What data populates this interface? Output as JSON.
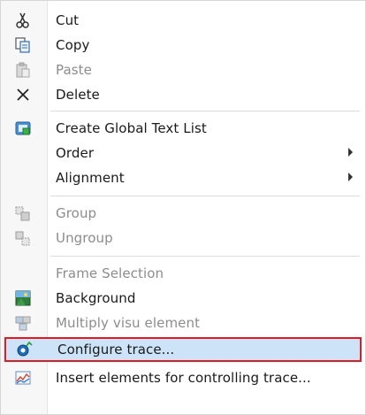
{
  "menu": {
    "items": [
      {
        "label": "Cut",
        "icon": "scissors-icon",
        "disabled": false
      },
      {
        "label": "Copy",
        "icon": "copy-icon",
        "disabled": false
      },
      {
        "label": "Paste",
        "icon": "paste-icon",
        "disabled": true
      },
      {
        "label": "Delete",
        "icon": "delete-icon",
        "disabled": false
      },
      {
        "label": "Create Global Text List",
        "icon": "text-list-icon",
        "disabled": false
      },
      {
        "label": "Order",
        "icon": "",
        "disabled": false,
        "submenu": true
      },
      {
        "label": "Alignment",
        "icon": "",
        "disabled": false,
        "submenu": true
      },
      {
        "label": "Group",
        "icon": "group-icon",
        "disabled": true
      },
      {
        "label": "Ungroup",
        "icon": "ungroup-icon",
        "disabled": true
      },
      {
        "label": "Frame Selection",
        "icon": "",
        "disabled": true
      },
      {
        "label": "Background",
        "icon": "background-icon",
        "disabled": false
      },
      {
        "label": "Multiply visu element",
        "icon": "multiply-icon",
        "disabled": true
      },
      {
        "label": "Configure trace...",
        "icon": "trace-config-icon",
        "disabled": false,
        "highlighted": true
      },
      {
        "label": "Insert elements for controlling trace...",
        "icon": "trace-insert-icon",
        "disabled": false
      }
    ]
  },
  "colors": {
    "highlight_bg": "#cde4f8",
    "highlight_border": "#e01b24",
    "disabled_text": "#8c8c8c"
  }
}
